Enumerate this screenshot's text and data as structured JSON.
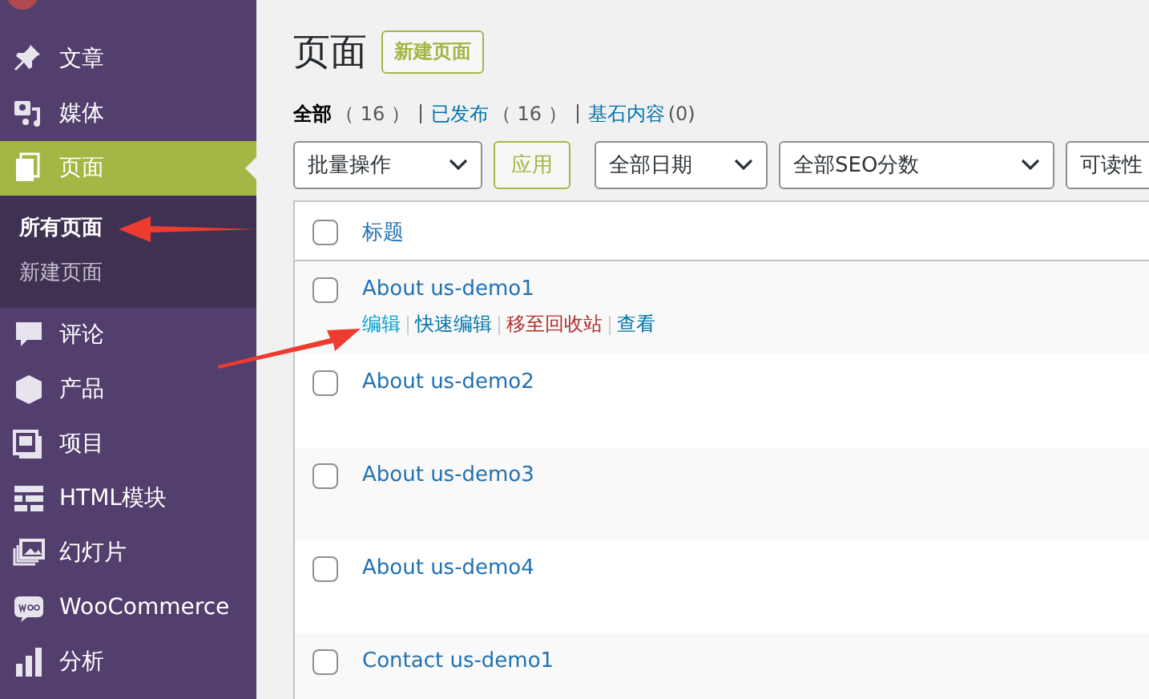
{
  "sidebar": {
    "items": [
      {
        "label": "文章",
        "selected": false
      },
      {
        "label": "媒体",
        "selected": false
      },
      {
        "label": "页面",
        "selected": true,
        "children": [
          {
            "label": "所有页面",
            "selected": true
          },
          {
            "label": "新建页面",
            "selected": false
          }
        ]
      },
      {
        "label": "评论",
        "selected": false
      },
      {
        "label": "产品",
        "selected": false
      },
      {
        "label": "项目",
        "selected": false
      },
      {
        "label": "HTML模块",
        "selected": false
      },
      {
        "label": "幻灯片",
        "selected": false
      },
      {
        "label": "WooCommerce",
        "selected": false
      },
      {
        "label": "分析",
        "selected": false
      }
    ]
  },
  "page": {
    "title": "页面",
    "add_button": "新建页面",
    "filters": [
      {
        "label": "全部",
        "count": "（ 16 ）",
        "selected": true
      },
      {
        "label": "已发布",
        "count": "（ 16 ）",
        "selected": false
      },
      {
        "label": "基石内容",
        "count": "(0)",
        "selected": false
      }
    ],
    "bulk_action": "批量操作",
    "apply_button": "应用",
    "selects": [
      "全部日期",
      "全部SEO分数",
      "可读性"
    ],
    "table": {
      "column_header": "标题",
      "select_all_checked": false,
      "rows": [
        {
          "title": "About us-demo1",
          "checked": false,
          "actions": [
            {
              "label": "编辑",
              "kind": "hover"
            },
            {
              "label": "快速编辑",
              "kind": "link"
            },
            {
              "label": "移至回收站",
              "kind": "delete"
            },
            {
              "label": "查看",
              "kind": "link"
            }
          ]
        },
        {
          "title": "About us-demo2",
          "checked": false
        },
        {
          "title": "About us-demo3",
          "checked": false
        },
        {
          "title": "About us-demo4",
          "checked": false
        },
        {
          "title": "Contact us-demo1",
          "checked": false
        }
      ]
    }
  }
}
